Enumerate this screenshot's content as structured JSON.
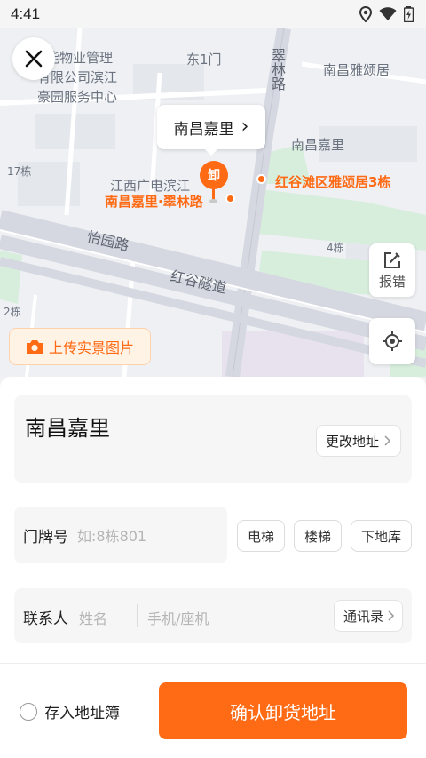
{
  "status_bar": {
    "time": "4:41",
    "icons": [
      "location-icon",
      "wifi-icon",
      "battery-icon"
    ]
  },
  "map": {
    "labels": {
      "l1": "能物业管理",
      "l2": "有限公司滨江",
      "l3": "豪园服务中心",
      "l4": "东1门",
      "l5": "翠林路",
      "l6": "南昌雅颂居",
      "l7": "南昌嘉里",
      "l8": "17栋",
      "l9": "江西广电滨江",
      "l10": "怡园路",
      "l11": "红谷隧道",
      "l12": "4栋",
      "l13": "2栋"
    },
    "orange_labels": {
      "poi1": "南昌嘉里·翠林路",
      "poi2": "红谷滩区雅颂居3栋"
    },
    "pin_label": "卸",
    "callout": {
      "text": "南昌嘉里",
      "chevron": "›"
    },
    "report_label": "报错",
    "upload_label": "上传实景图片",
    "colors": {
      "accent": "#ff6a14",
      "road": "#d5d8e0",
      "park": "#d8eedd"
    }
  },
  "address": {
    "title": "南昌嘉里",
    "change_label": "更改地址"
  },
  "door": {
    "label": "门牌号",
    "placeholder": "如:8栋801"
  },
  "chips": [
    "电梯",
    "楼梯",
    "下地库"
  ],
  "contact": {
    "label": "联系人",
    "name_placeholder": "姓名",
    "phone_placeholder": "手机/座机",
    "contacts_label": "通讯录"
  },
  "footer": {
    "save_label": "存入地址簿",
    "confirm_label": "确认卸货地址"
  }
}
